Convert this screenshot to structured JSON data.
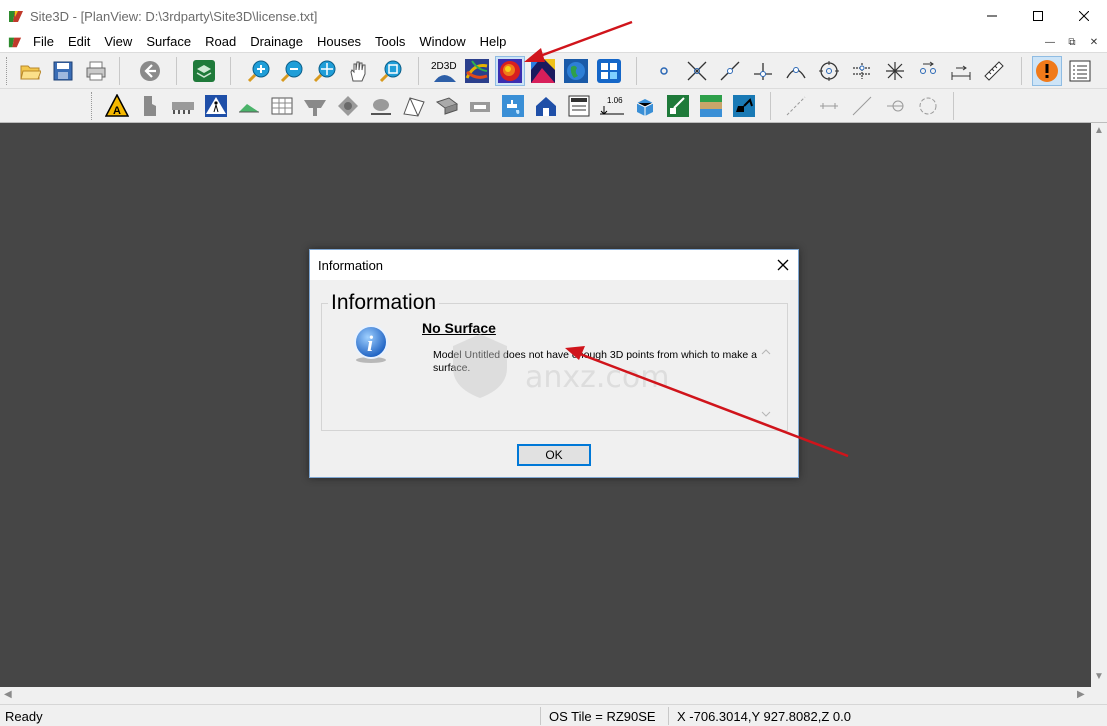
{
  "window": {
    "title": "Site3D - [PlanView: D:\\3rdparty\\Site3D\\license.txt]"
  },
  "menu": {
    "items": [
      "File",
      "Edit",
      "View",
      "Surface",
      "Road",
      "Drainage",
      "Houses",
      "Tools",
      "Window",
      "Help"
    ]
  },
  "toolbar": {
    "tool_2d3d_label": "2D3D",
    "level_label": "1.06",
    "icons": [
      "open-icon",
      "save-icon",
      "print-icon",
      "back-icon",
      "layers-icon",
      "zoom-in-icon",
      "zoom-out-icon",
      "zoom-extents-icon",
      "pan-hand-icon",
      "zoom-window-icon",
      "2d3d-icon",
      "contour-surface-icon",
      "colour-surface-icon",
      "surface-plot-icon",
      "globe-icon",
      "grid-points-icon",
      "point-icon",
      "intersection-icon",
      "line-point-icon",
      "perpendicular-icon",
      "arc-icon",
      "circle-target-icon",
      "offset-icon",
      "star-icon",
      "move-point-icon",
      "measure-icon",
      "ruler-icon",
      "warning-icon",
      "report-icon"
    ]
  },
  "dialog": {
    "title": "Information",
    "heading": "Information",
    "subtitle": "No Surface",
    "message": "Model Untitled does not have enough 3D points from which to make a surface.",
    "ok_label": "OK"
  },
  "watermark": {
    "text": "anxz.com"
  },
  "status": {
    "ready": "Ready",
    "tile": "OS Tile = RZ90SE",
    "coords": "X -706.3014,Y 927.8082,Z 0.0"
  },
  "colors": {
    "workspace": "#464646",
    "accent": "#0078d7",
    "arrow": "#d0141b"
  }
}
